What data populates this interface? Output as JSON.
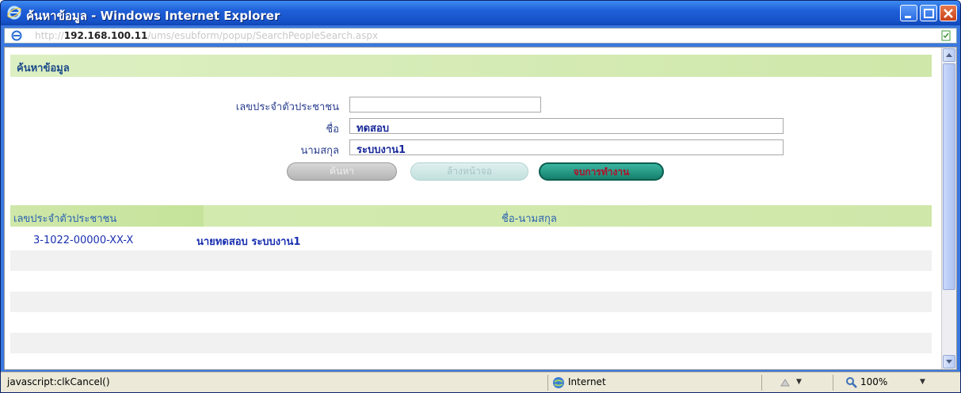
{
  "window": {
    "title": "ค้นหาข้อมูล - Windows Internet Explorer",
    "address": {
      "prefix": "http://",
      "host": "192.168.100.11",
      "path": "/ums/esubform/popup/SearchPeopleSearch.aspx"
    }
  },
  "page": {
    "section_title": "ค้นหาข้อมูล",
    "form": {
      "id_label": "เลขประจำตัวประชาชน",
      "id_value": "",
      "name_label": "ชื่อ",
      "name_value": "ทดสอบ",
      "surname_label": "นามสกุล",
      "surname_value": "ระบบงาน1"
    },
    "buttons": {
      "search": "ค้นหา",
      "clear": "ล้างหน้าจอ",
      "end": "จบการทำงาน"
    },
    "results": {
      "columns": [
        "เลขประจำตัวประชาชน",
        "ชื่อ-นามสกุล"
      ],
      "rows": [
        {
          "id": "3-1022-00000-XX-X",
          "name": "นายทดสอบ  ระบบงาน1"
        }
      ]
    }
  },
  "statusbar": {
    "text": "javascript:clkCancel()",
    "zone": "Internet",
    "zoom": "100%"
  },
  "colors": {
    "titlebar": "#1e5fd8",
    "header_band": "#d4ebb1",
    "accent_text": "#2a3e8e",
    "end_button": "#1a8a76"
  }
}
